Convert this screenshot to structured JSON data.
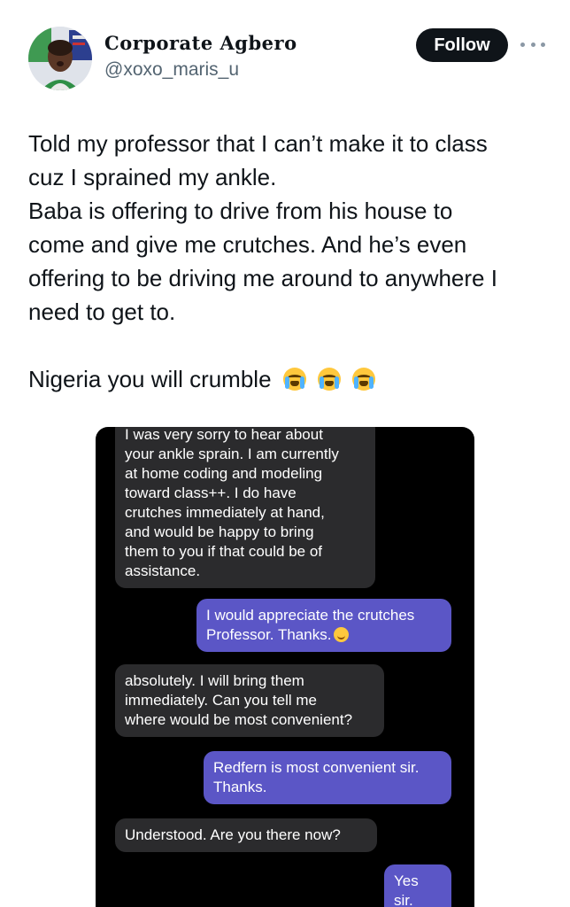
{
  "author": {
    "display_name": "Corporate Agbero",
    "handle": "@xoxo_maris_u",
    "avatar_icon": "profile-avatar"
  },
  "actions": {
    "follow_label": "Follow",
    "more_icon": "more-dots-icon"
  },
  "tweet": {
    "paragraph1_line1": "Told my professor that I can’t make it to class",
    "paragraph1_line2": "cuz I sprained my ankle.",
    "paragraph2_line1": "Baba is offering to drive from his house to",
    "paragraph2_line2": "come and give me crutches. And he’s even",
    "paragraph2_line3": "offering to be driving me around to anywhere I",
    "paragraph2_line4": "need to get to.",
    "paragraph3": "Nigeria you will crumble",
    "emoji": [
      "loudly-crying-face",
      "loudly-crying-face",
      "loudly-crying-face"
    ]
  },
  "chat": {
    "messages": [
      {
        "from": "professor",
        "lines": [
          "I was very sorry to hear about",
          "your ankle sprain.  I am currently",
          "at home coding and modeling",
          "toward class++.  I do have",
          "crutches immediately at hand,",
          "and would be happy to bring",
          "them to you if that could be of",
          "assistance."
        ]
      },
      {
        "from": "student",
        "lines": [
          "I would appreciate the crutches",
          "Professor. Thanks."
        ],
        "emoji": "smiling-face"
      },
      {
        "from": "professor",
        "lines": [
          "absolutely.  I will bring them",
          "immediately.  Can you tell me",
          "where would be most convenient?"
        ]
      },
      {
        "from": "student",
        "lines": [
          "Redfern is most convenient sir.",
          "Thanks."
        ]
      },
      {
        "from": "professor",
        "lines": [
          "Understood.  Are you there now?"
        ]
      },
      {
        "from": "student",
        "lines": [
          "Yes sir."
        ]
      }
    ],
    "colors": {
      "background": "#000000",
      "incoming": "#2b2b2d",
      "outgoing": "#5b56c6"
    }
  }
}
